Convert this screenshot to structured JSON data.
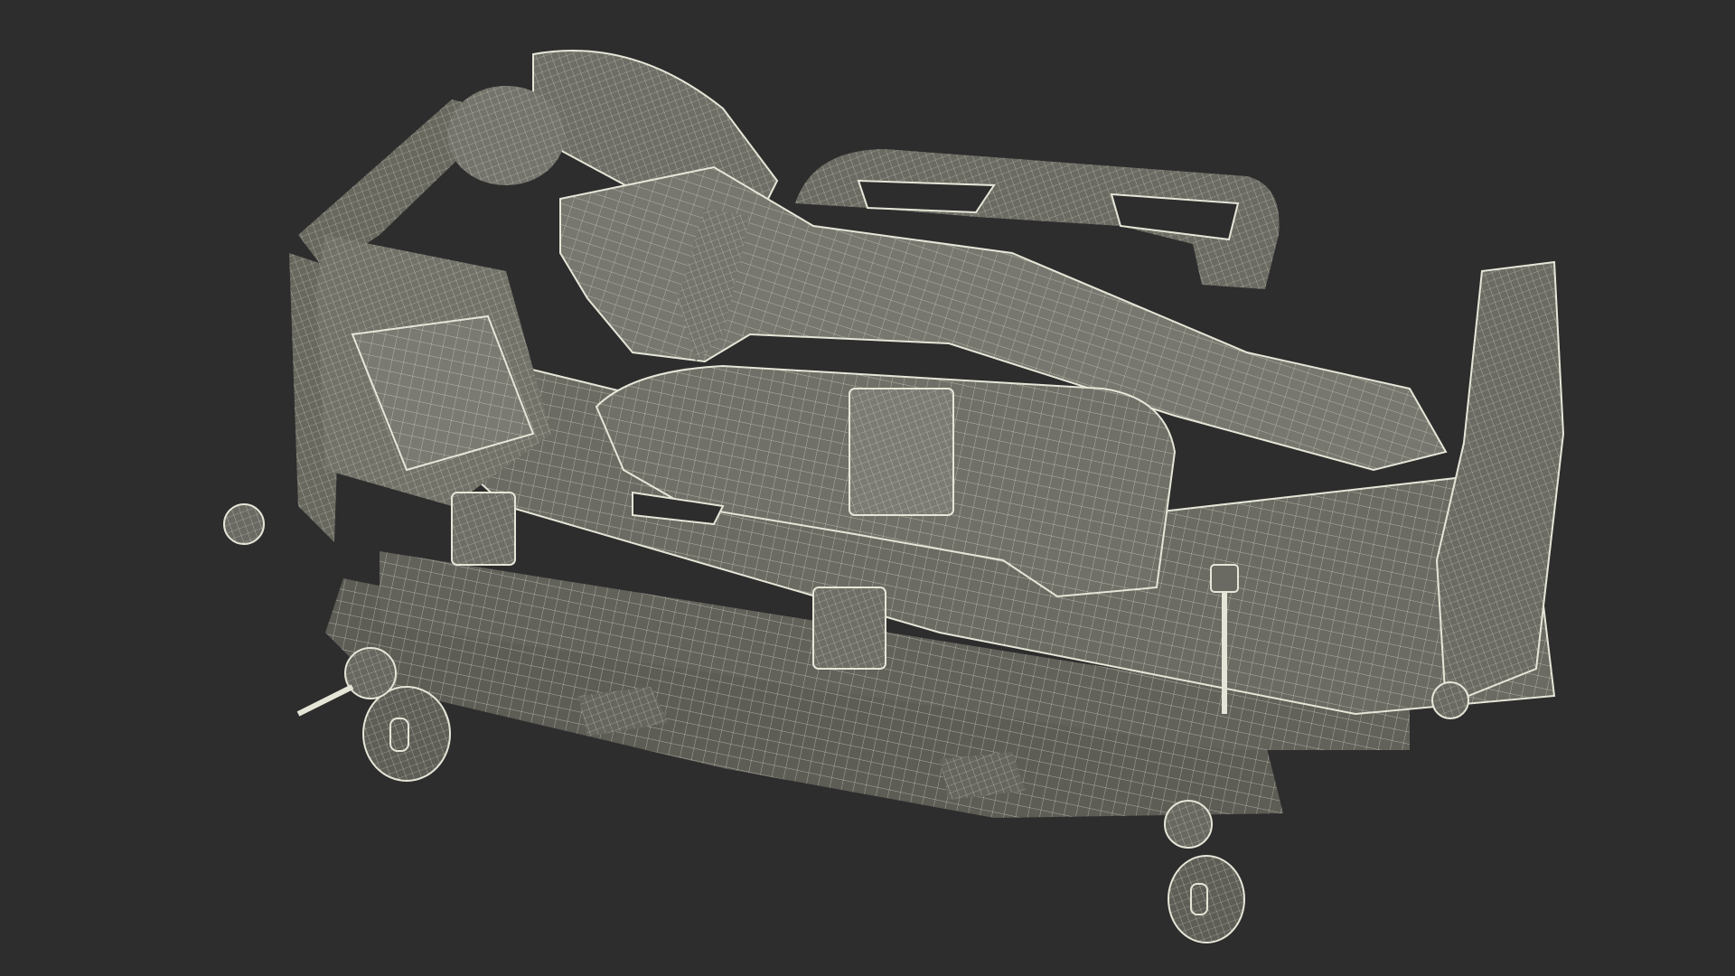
{
  "scene": {
    "subject": "wireframe-hospital-bed-with-patient",
    "colors": {
      "background": "#2d2d2d",
      "surface": "#6b6b63",
      "surface_light": "#7a7a72",
      "surface_dark": "#55554e",
      "wire": "#e6e6d8",
      "shadow": "#3d3d39"
    }
  }
}
